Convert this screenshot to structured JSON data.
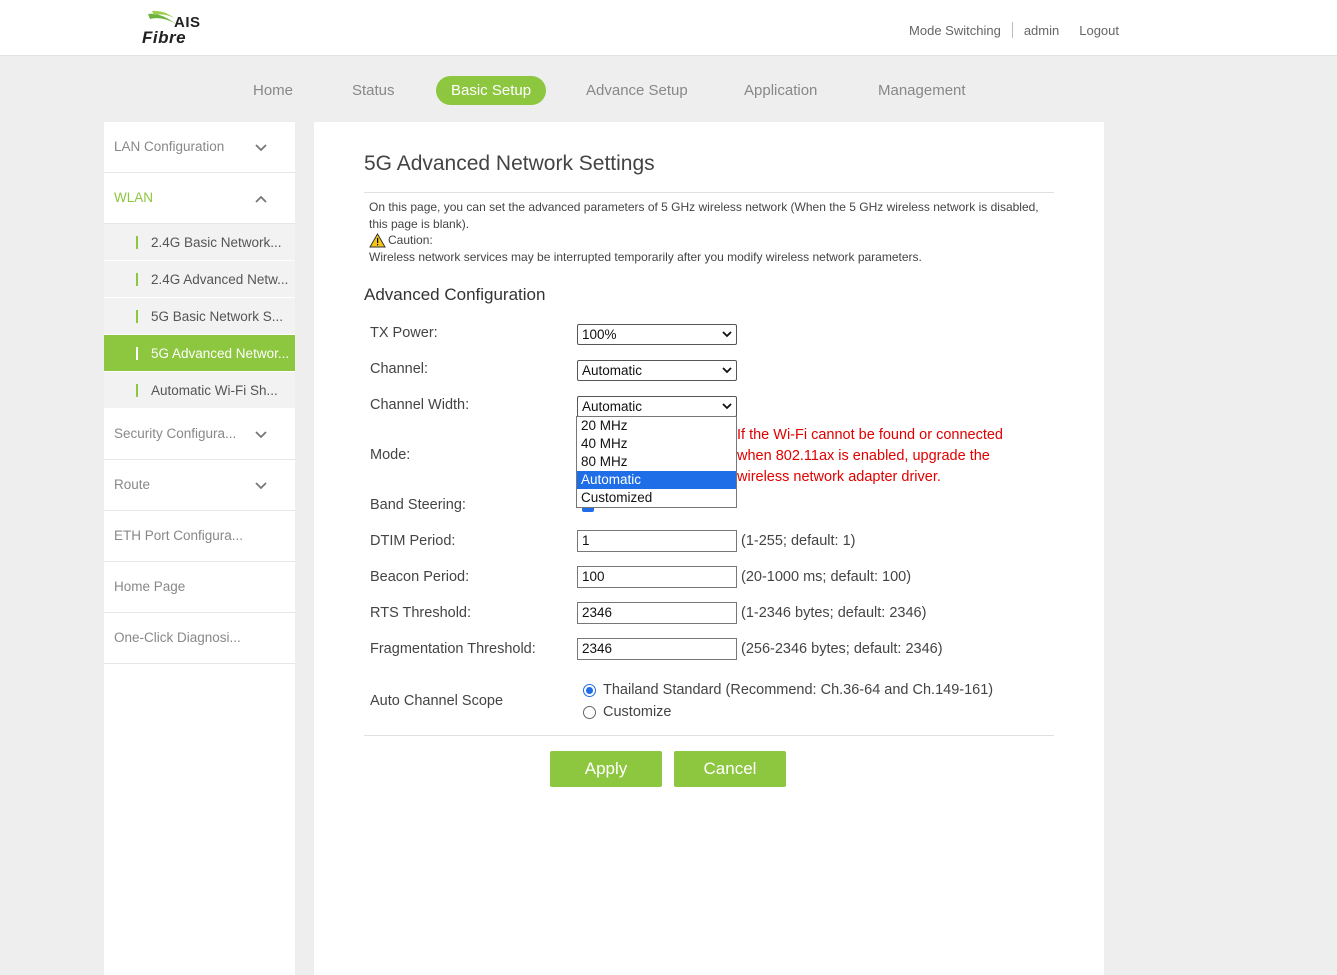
{
  "header": {
    "logo_top": "AIS",
    "logo_bottom": "Fibre",
    "links": [
      "Mode Switching",
      "admin",
      "Logout"
    ]
  },
  "nav": [
    "Home",
    "Status",
    "Basic Setup",
    "Advance Setup",
    "Application",
    "Management"
  ],
  "sidebar": {
    "sections": {
      "lan": "LAN Configuration",
      "wlan": "WLAN",
      "security": "Security Configura...",
      "route": "Route",
      "eth": "ETH Port Configura...",
      "home": "Home Page",
      "diag": "One-Click Diagnosi..."
    },
    "wlan_items": [
      "2.4G Basic Network...",
      "2.4G Advanced Netw...",
      "5G Basic Network S...",
      "5G Advanced Networ...",
      "Automatic Wi-Fi Sh..."
    ]
  },
  "page": {
    "title": "5G Advanced Network Settings",
    "description": "On this page, you can set the advanced parameters of 5 GHz wireless network (When the 5 GHz wireless network is disabled, this page is blank).",
    "caution_label": "Caution:",
    "caution_text": "Wireless network services may be interrupted temporarily after you modify wireless network parameters.",
    "section_title": "Advanced Configuration"
  },
  "form": {
    "tx_power": {
      "label": "TX Power:",
      "value": "100%"
    },
    "channel": {
      "label": "Channel:",
      "value": "Automatic"
    },
    "channel_width": {
      "label": "Channel Width:",
      "value": "Automatic",
      "options": [
        "20 MHz",
        "40 MHz",
        "80 MHz",
        "Automatic",
        "Customized"
      ]
    },
    "mode": {
      "label": "Mode:",
      "warning": "If the Wi-Fi cannot be found or connected when 802.11ax is enabled, upgrade the wireless network adapter driver."
    },
    "band_steering": {
      "label": "Band Steering:"
    },
    "dtim": {
      "label": "DTIM Period:",
      "value": "1",
      "hint": "(1-255; default: 1)"
    },
    "beacon": {
      "label": "Beacon Period:",
      "value": "100",
      "hint": "(20-1000 ms; default: 100)"
    },
    "rts": {
      "label": "RTS Threshold:",
      "value": "2346",
      "hint": "(1-2346 bytes; default: 2346)"
    },
    "frag": {
      "label": "Fragmentation Threshold:",
      "value": "2346",
      "hint": "(256-2346 bytes; default: 2346)"
    },
    "scope": {
      "label": "Auto Channel Scope",
      "option1": "Thailand Standard (Recommend: Ch.36-64 and Ch.149-161)",
      "option2": "Customize"
    }
  },
  "buttons": {
    "apply": "Apply",
    "cancel": "Cancel"
  },
  "colors": {
    "accent": "#8dc63f",
    "warning": "#e00000",
    "selection": "#1f6ee8"
  }
}
